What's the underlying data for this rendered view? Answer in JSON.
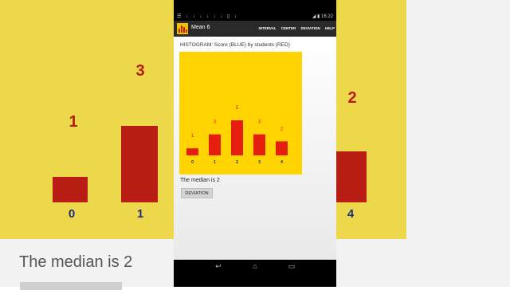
{
  "status_bar": {
    "time": "16:22"
  },
  "app": {
    "title": "Mean 6"
  },
  "menu": {
    "items": [
      "INTERVAL",
      "CENTER",
      "DEVIATION",
      "HELP"
    ]
  },
  "histogram": {
    "title": "HISTOGRAM: Score (BLUE) by students (RED)"
  },
  "chart_data": {
    "type": "bar",
    "categories": [
      "0",
      "1",
      "2",
      "3",
      "4"
    ],
    "values": [
      1,
      3,
      5,
      3,
      2
    ],
    "ylim": [
      0,
      5
    ],
    "title": "HISTOGRAM: Score (BLUE) by students (RED)",
    "xlabel": "",
    "ylabel": ""
  },
  "result": {
    "median_text": "The median is 2"
  },
  "button": {
    "label": "DEVIATION"
  },
  "background": {
    "values": [
      "1",
      "3",
      "2"
    ],
    "ticks": [
      "0",
      "1",
      "4"
    ],
    "median_text": "The median is 2"
  },
  "colors": {
    "chart_bg": "#ffd400",
    "bar": "#e61e10",
    "count_label": "#e61e10",
    "tick_label": "#1a237e"
  },
  "icons": [
    "app-histogram-icon",
    "back-icon",
    "home-icon",
    "recent-apps-icon"
  ]
}
